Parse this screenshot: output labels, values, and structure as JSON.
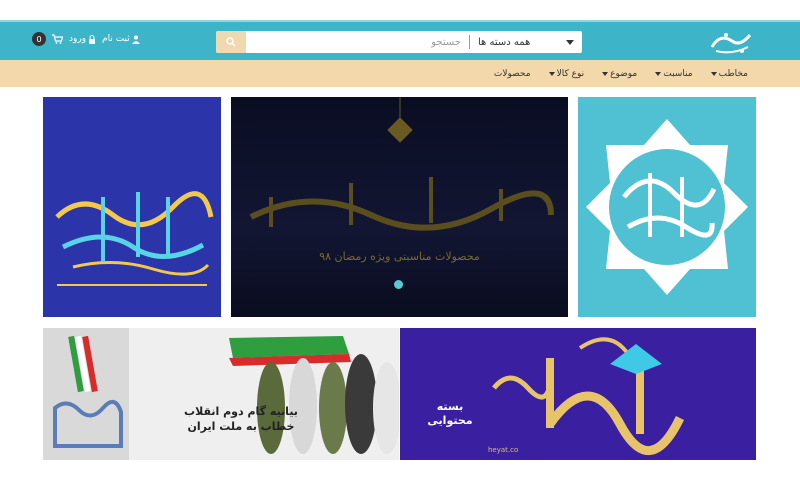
{
  "header": {
    "search": {
      "category": "همه دسته ها",
      "placeholder": "جستجو"
    },
    "user": {
      "cart_count": "0",
      "login_label": "ورود",
      "register_label": "ثبت نام"
    }
  },
  "nav": {
    "items": [
      {
        "label": "محصولات"
      },
      {
        "label": "نوع کالا"
      },
      {
        "label": "موضوع"
      },
      {
        "label": "مناسبت"
      },
      {
        "label": "مخاطب"
      }
    ]
  },
  "slider": {
    "caption": "محصولات مناسبتی ویژه رمضان ۹۸"
  },
  "promo_left": {
    "text": "بیانیه گام دوم انقلاب\nخطاب به ملت ایران"
  },
  "promo_right": {
    "text": "بسته\nمحتوایی",
    "site": "heyat.co"
  },
  "colors": {
    "topbar": "#3db4c8",
    "navbar": "#f2d8ab",
    "accent": "#f0d9b0"
  }
}
